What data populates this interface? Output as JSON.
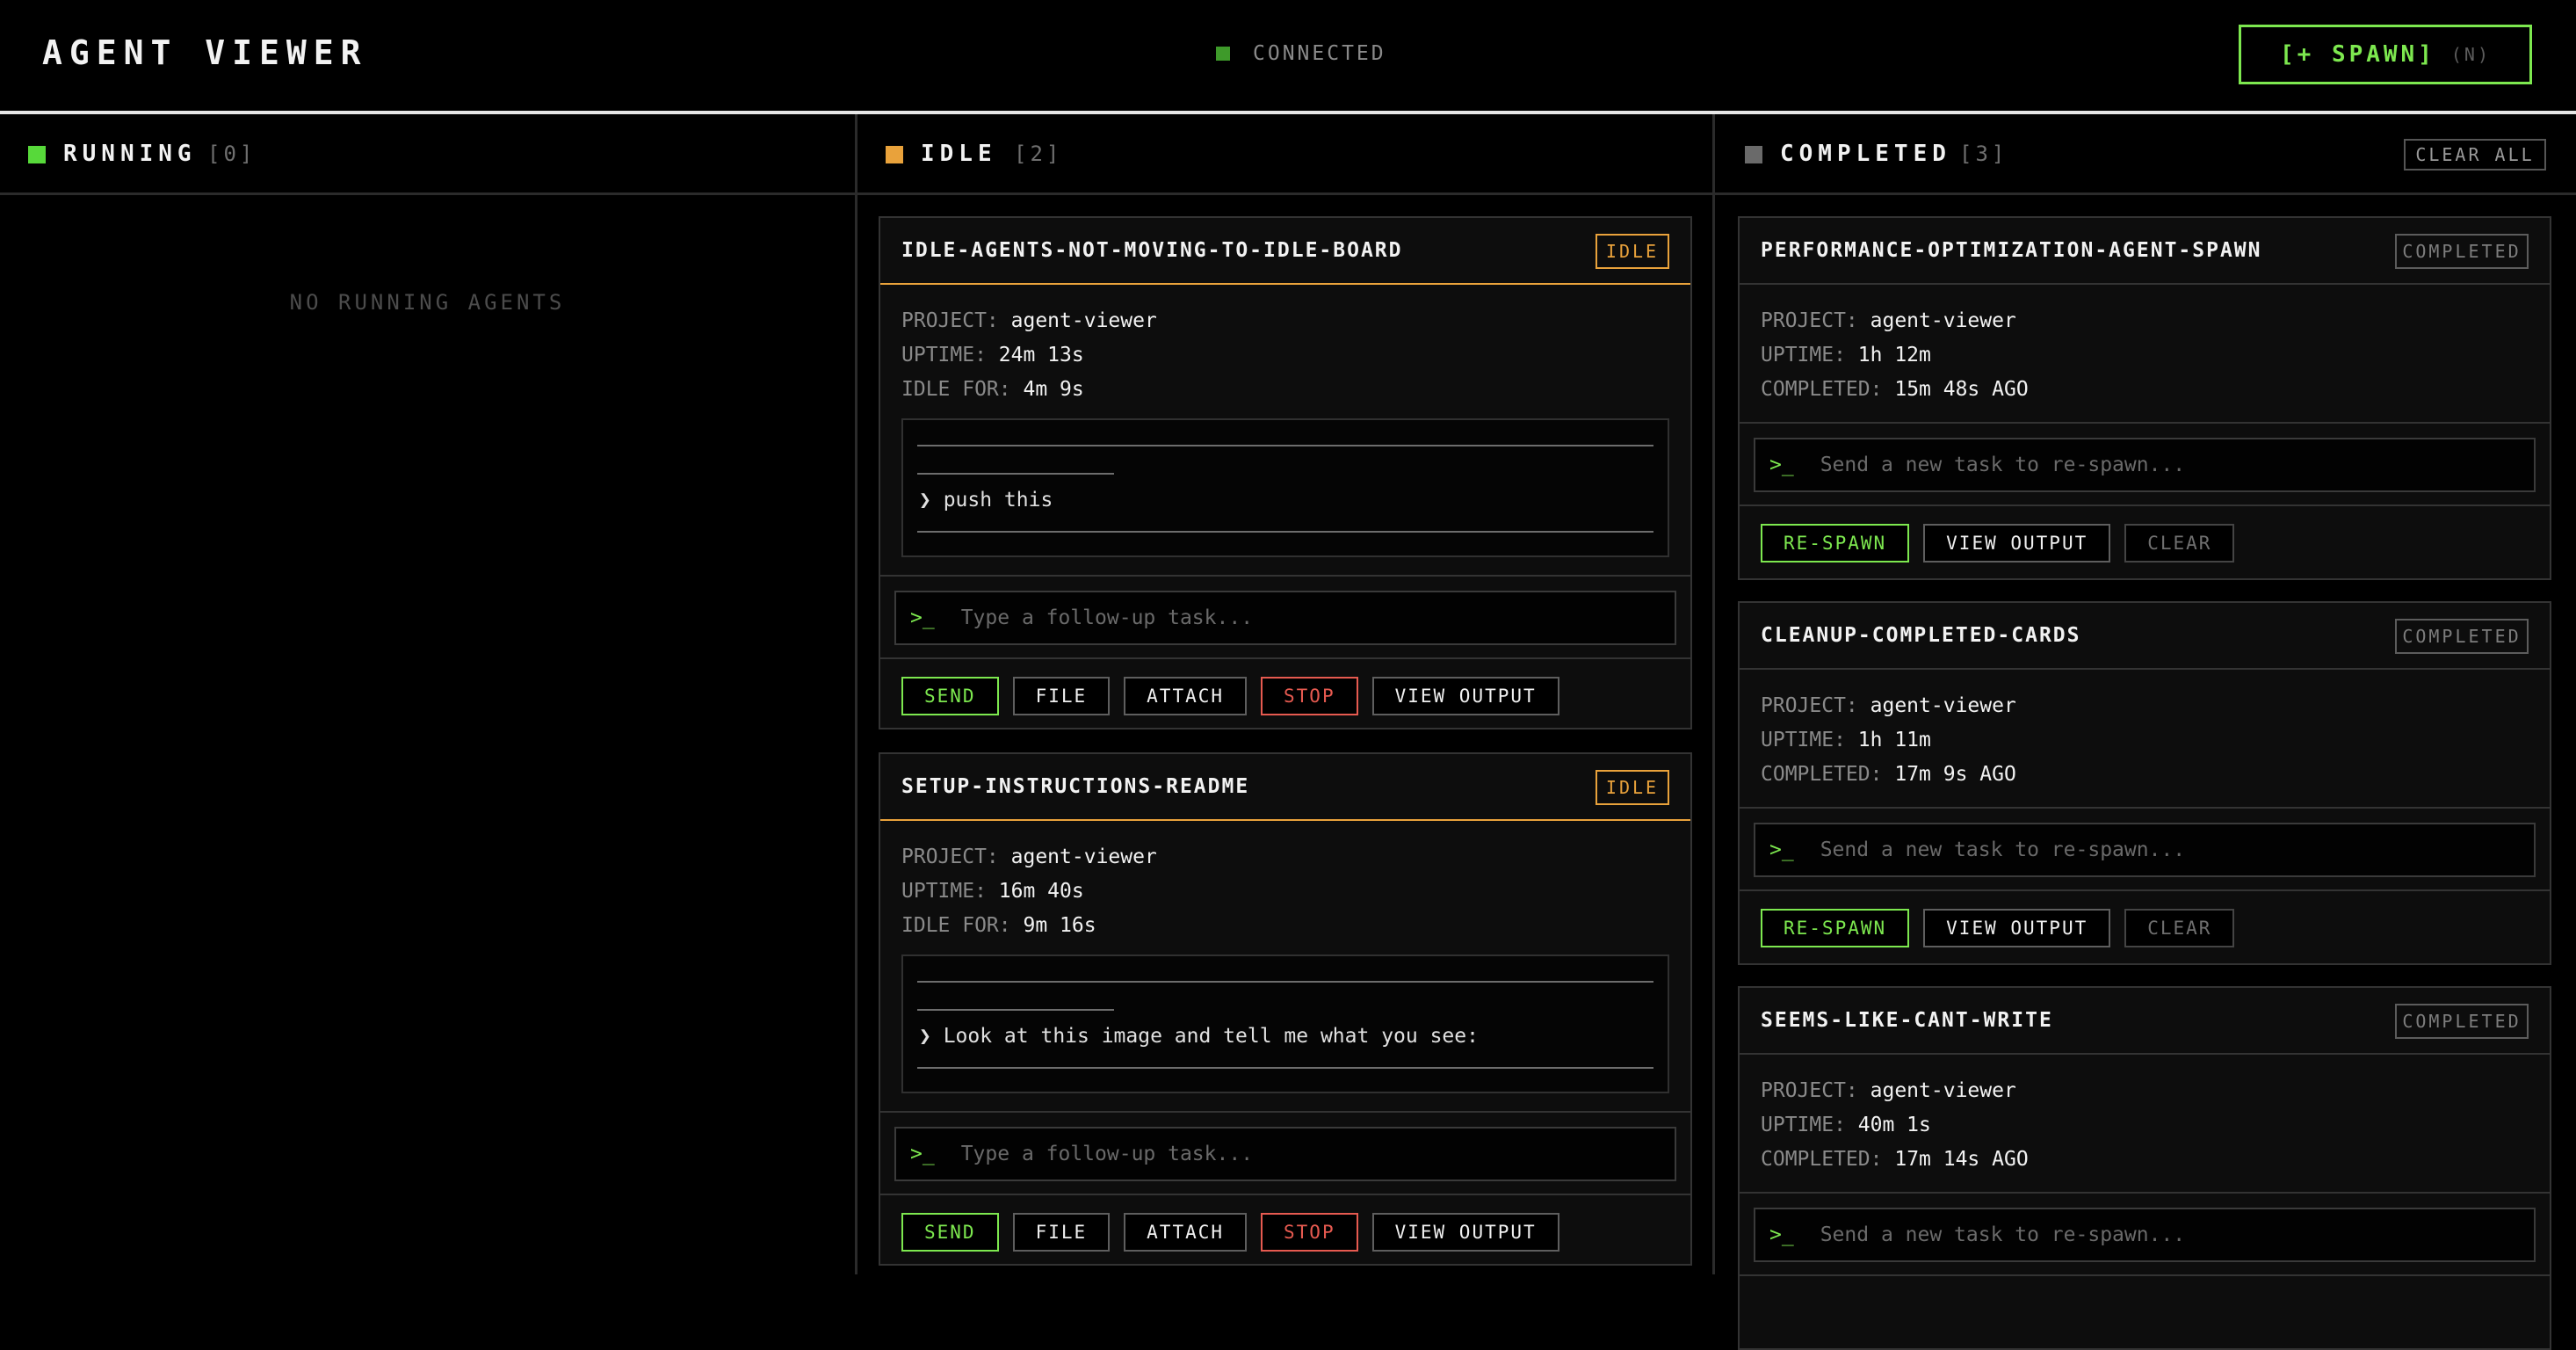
{
  "header": {
    "title": "AGENT VIEWER",
    "status": "CONNECTED",
    "spawn_label": "[+ SPAWN]",
    "spawn_shortcut": "(N)"
  },
  "colors": {
    "running": "#57d93a",
    "idle": "#e9a23b",
    "completed": "#6a6a6a",
    "accent": "#7de84f",
    "danger": "#e65a50"
  },
  "columns": {
    "running": {
      "title": "RUNNING",
      "count": "[0]",
      "empty": "NO RUNNING AGENTS"
    },
    "idle": {
      "title": "IDLE",
      "count": "[2]"
    },
    "completed": {
      "title": "COMPLETED",
      "count": "[3]",
      "clear_all": "CLEAR ALL"
    }
  },
  "labels": {
    "project": "PROJECT:",
    "uptime": "UPTIME:",
    "idle_for": "IDLE FOR:",
    "completed": "COMPLETED:",
    "prompt": ">_",
    "followup_placeholder": "Type a follow-up task...",
    "respawn_placeholder": "Send a new task to re-spawn...",
    "send": "SEND",
    "file": "FILE",
    "attach": "ATTACH",
    "stop": "STOP",
    "view_output": "VIEW OUTPUT",
    "respawn": "RE-SPAWN",
    "clear": "CLEAR"
  },
  "idle_agents": [
    {
      "name": "IDLE-AGENTS-NOT-MOVING-TO-IDLE-BOARD",
      "badge": "IDLE",
      "project": "agent-viewer",
      "uptime": "24m 13s",
      "idle_for": "4m 9s",
      "last_prompt": "❯ push this"
    },
    {
      "name": "SETUP-INSTRUCTIONS-README",
      "badge": "IDLE",
      "project": "agent-viewer",
      "uptime": "16m 40s",
      "idle_for": "9m 16s",
      "last_prompt": "❯ Look at this image and tell me what you see:"
    }
  ],
  "completed_agents": [
    {
      "name": "PERFORMANCE-OPTIMIZATION-AGENT-SPAWN",
      "badge": "COMPLETED",
      "project": "agent-viewer",
      "uptime": "1h 12m",
      "completed": "15m 48s AGO"
    },
    {
      "name": "CLEANUP-COMPLETED-CARDS",
      "badge": "COMPLETED",
      "project": "agent-viewer",
      "uptime": "1h 11m",
      "completed": "17m 9s AGO"
    },
    {
      "name": "SEEMS-LIKE-CANT-WRITE",
      "badge": "COMPLETED",
      "project": "agent-viewer",
      "uptime": "40m 1s",
      "completed": "17m 14s AGO"
    }
  ]
}
